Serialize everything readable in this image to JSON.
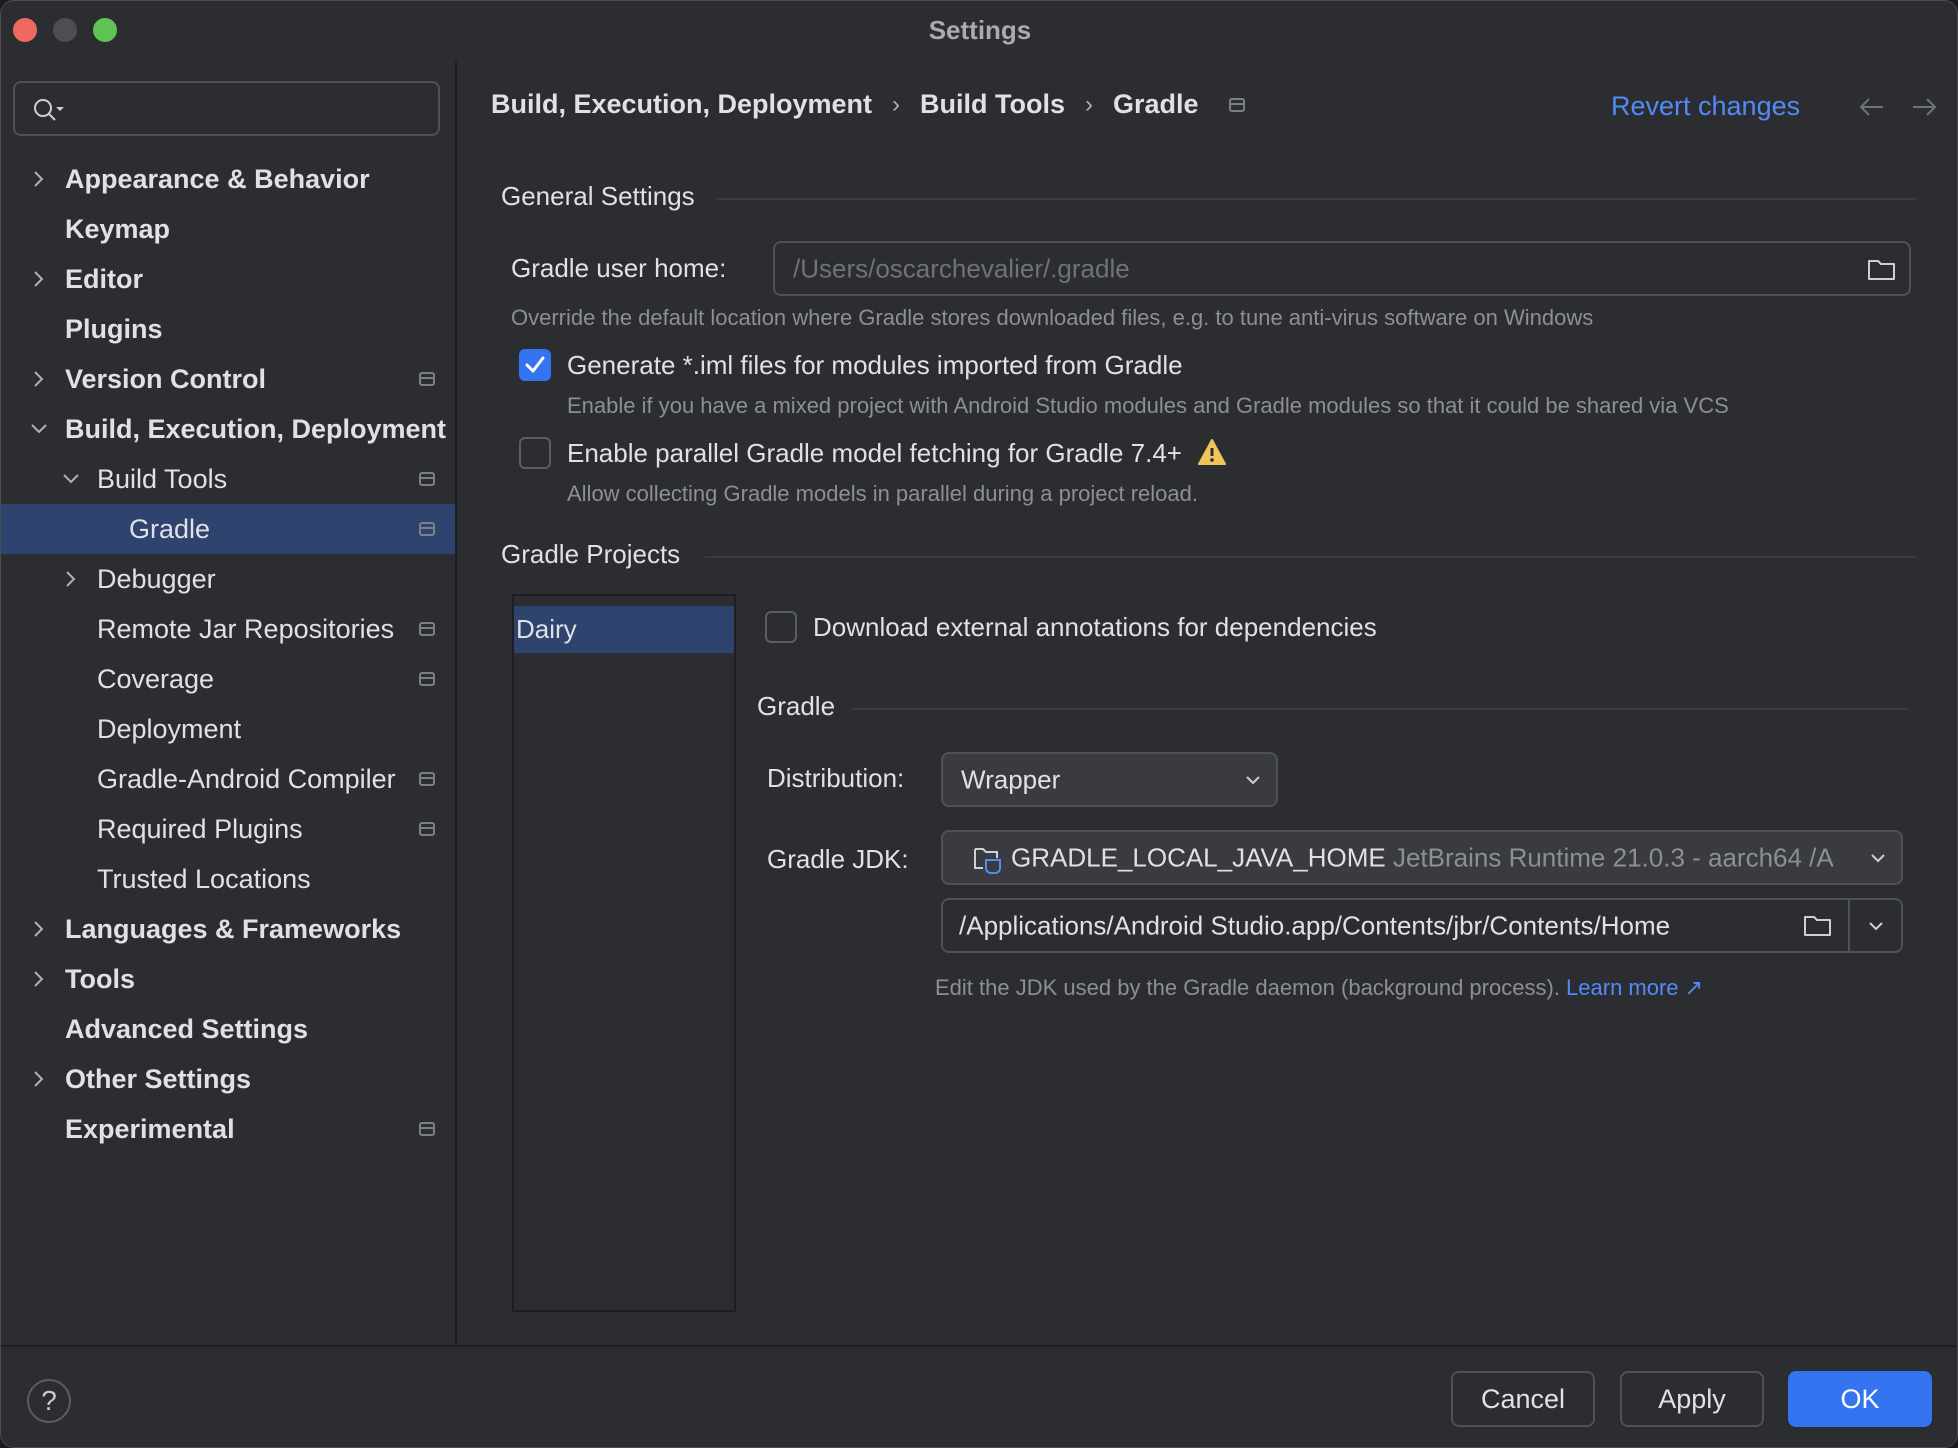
{
  "window": {
    "title": "Settings"
  },
  "search": {
    "placeholder": "",
    "value": ""
  },
  "sidebar": {
    "items": [
      {
        "label": "Appearance & Behavior",
        "level": 0,
        "bold": true,
        "expander": "collapsed",
        "project_icon": false
      },
      {
        "label": "Keymap",
        "level": 0,
        "bold": true,
        "expander": "none",
        "project_icon": false
      },
      {
        "label": "Editor",
        "level": 0,
        "bold": true,
        "expander": "collapsed",
        "project_icon": false
      },
      {
        "label": "Plugins",
        "level": 0,
        "bold": true,
        "expander": "none",
        "project_icon": false
      },
      {
        "label": "Version Control",
        "level": 0,
        "bold": true,
        "expander": "collapsed",
        "project_icon": true
      },
      {
        "label": "Build, Execution, Deployment",
        "level": 0,
        "bold": true,
        "expander": "expanded",
        "project_icon": false
      },
      {
        "label": "Build Tools",
        "level": 1,
        "bold": false,
        "expander": "expanded",
        "project_icon": true
      },
      {
        "label": "Gradle",
        "level": 2,
        "bold": false,
        "expander": "none",
        "project_icon": true,
        "selected": true
      },
      {
        "label": "Debugger",
        "level": 1,
        "bold": false,
        "expander": "collapsed",
        "project_icon": false
      },
      {
        "label": "Remote Jar Repositories",
        "level": 1,
        "bold": false,
        "expander": "none",
        "project_icon": true
      },
      {
        "label": "Coverage",
        "level": 1,
        "bold": false,
        "expander": "none",
        "project_icon": true
      },
      {
        "label": "Deployment",
        "level": 1,
        "bold": false,
        "expander": "none",
        "project_icon": false
      },
      {
        "label": "Gradle-Android Compiler",
        "level": 1,
        "bold": false,
        "expander": "none",
        "project_icon": true
      },
      {
        "label": "Required Plugins",
        "level": 1,
        "bold": false,
        "expander": "none",
        "project_icon": true
      },
      {
        "label": "Trusted Locations",
        "level": 1,
        "bold": false,
        "expander": "none",
        "project_icon": false
      },
      {
        "label": "Languages & Frameworks",
        "level": 0,
        "bold": true,
        "expander": "collapsed",
        "project_icon": false
      },
      {
        "label": "Tools",
        "level": 0,
        "bold": true,
        "expander": "collapsed",
        "project_icon": false
      },
      {
        "label": "Advanced Settings",
        "level": 0,
        "bold": true,
        "expander": "none",
        "project_icon": false
      },
      {
        "label": "Other Settings",
        "level": 0,
        "bold": true,
        "expander": "collapsed",
        "project_icon": false
      },
      {
        "label": "Experimental",
        "level": 0,
        "bold": true,
        "expander": "none",
        "project_icon": true
      }
    ]
  },
  "header": {
    "breadcrumb": [
      "Build, Execution, Deployment",
      "Build Tools",
      "Gradle"
    ],
    "breadcrumb_separator": "›",
    "revert_label": "Revert changes"
  },
  "general": {
    "title": "General Settings",
    "user_home_label": "Gradle user home:",
    "user_home_placeholder": "/Users/oscarchevalier/.gradle",
    "user_home_hint": "Override the default location where Gradle stores downloaded files, e.g. to tune anti-virus software on Windows",
    "generate_iml": {
      "label": "Generate *.iml files for modules imported from Gradle",
      "checked": true,
      "hint": "Enable if you have a mixed project with Android Studio modules and Gradle modules so that it could be shared via VCS"
    },
    "parallel_fetch": {
      "label": "Enable parallel Gradle model fetching for Gradle 7.4+",
      "checked": false,
      "hint": "Allow collecting Gradle models in parallel during a project reload."
    }
  },
  "projects": {
    "title": "Gradle Projects",
    "list": [
      "Dairy"
    ],
    "selected": "Dairy",
    "download_annotations": {
      "label": "Download external annotations for dependencies",
      "checked": false
    },
    "gradle_section_title": "Gradle",
    "distribution_label": "Distribution:",
    "distribution_value": "Wrapper",
    "jdk_label": "Gradle JDK:",
    "jdk_name": "GRADLE_LOCAL_JAVA_HOME",
    "jdk_detail": "JetBrains Runtime 21.0.3 - aarch64 /A",
    "jdk_path": "/Applications/Android Studio.app/Contents/jbr/Contents/Home",
    "jdk_hint": "Edit the JDK used by the Gradle daemon (background process).",
    "learn_more": "Learn more ↗"
  },
  "footer": {
    "help": "?",
    "cancel": "Cancel",
    "apply": "Apply",
    "ok": "OK"
  },
  "colors": {
    "accent": "#3574f0",
    "link": "#548af7",
    "selection": "#2e436e",
    "warning": "#f2c55c",
    "background": "#2b2d30"
  }
}
